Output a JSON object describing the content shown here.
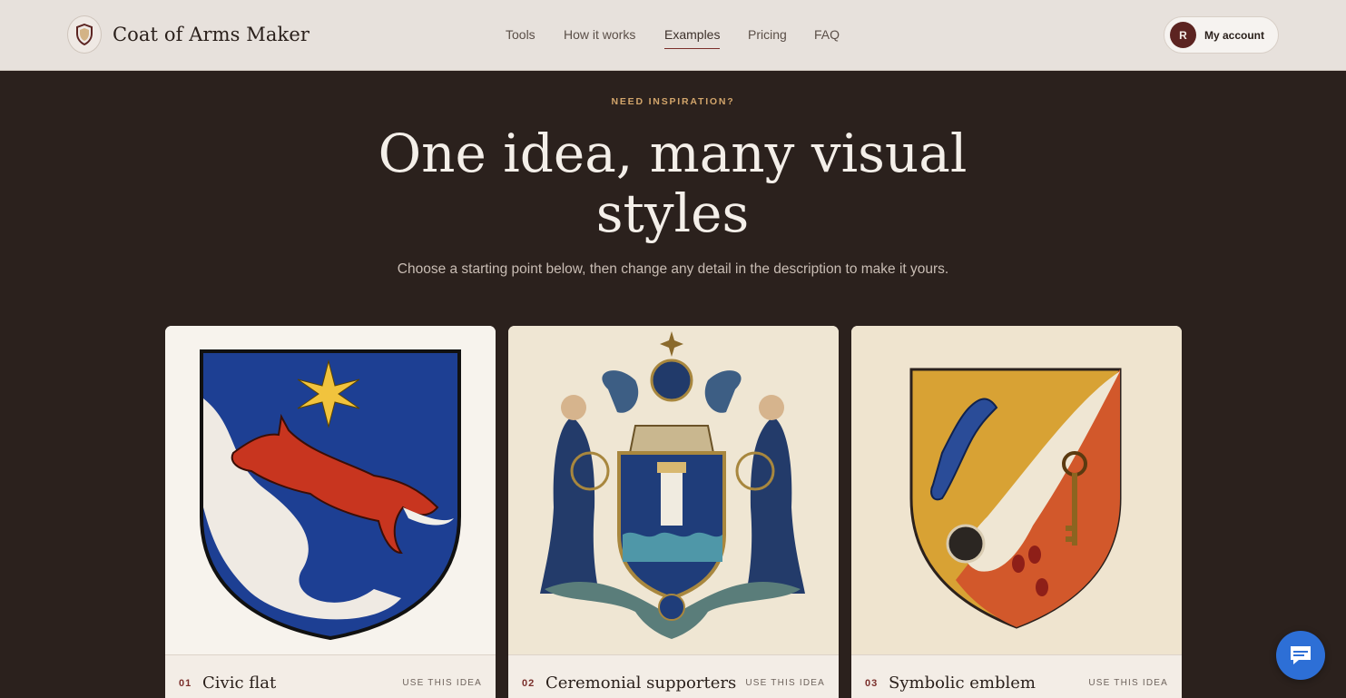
{
  "header": {
    "brand": "Coat of Arms Maker",
    "nav": [
      "Tools",
      "How it works",
      "Examples",
      "Pricing",
      "FAQ"
    ],
    "active_nav": "Examples",
    "account": {
      "initial": "R",
      "label": "My account"
    }
  },
  "hero": {
    "eyebrow": "NEED INSPIRATION?",
    "title": "One idea, many visual styles",
    "subtitle": "Choose a starting point below, then change any detail in the description to make it yours."
  },
  "cards": [
    {
      "num": "01",
      "title": "Civic flat",
      "action": "USE THIS IDEA"
    },
    {
      "num": "02",
      "title": "Ceremonial supporters",
      "action": "USE THIS IDEA"
    },
    {
      "num": "03",
      "title": "Symbolic emblem",
      "action": "USE THIS IDEA"
    }
  ],
  "colors": {
    "accent": "#7a2f2b",
    "gold": "#d2a56b",
    "background": "#2b211d",
    "chat": "#2d6fd6"
  }
}
